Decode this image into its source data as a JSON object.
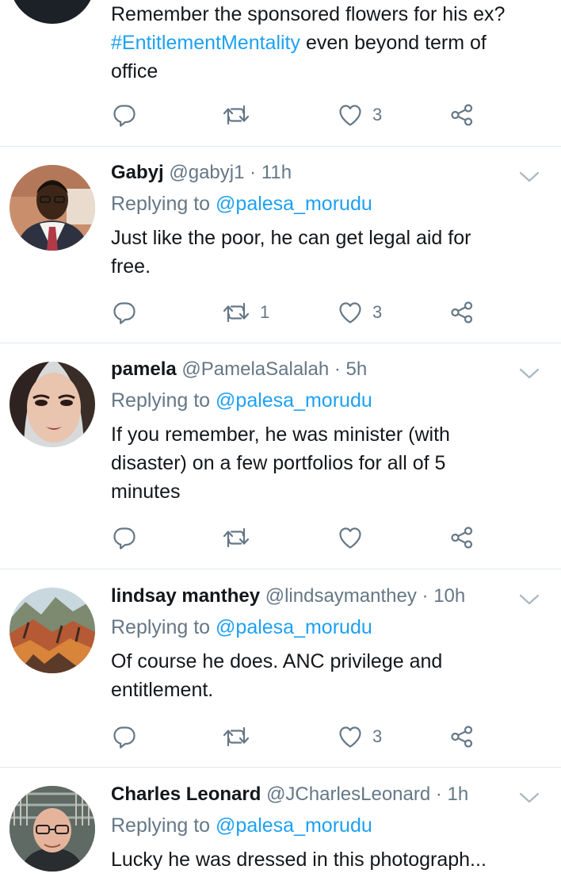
{
  "tweets": [
    {
      "body_line1": "Remember the sponsored flowers for his ex?",
      "hashtag": "#EntitlementMentality",
      "body_rest1": " even beyond term of",
      "body_line3": "office",
      "counts": {
        "reply": "",
        "retweet": "",
        "like": "3"
      }
    },
    {
      "name": "Gabyj",
      "handle": "@gabyj1",
      "time": "11h",
      "replying_prefix": "Replying to",
      "replying_to": "@palesa_morudu",
      "text": "Just like the poor, he can get legal aid for free.",
      "counts": {
        "reply": "",
        "retweet": "1",
        "like": "3"
      }
    },
    {
      "name": "pamela",
      "handle": "@PamelaSalalah",
      "time": "5h",
      "replying_prefix": "Replying to",
      "replying_to": "@palesa_morudu",
      "text": "If you remember, he was minister (with disaster) on a few portfolios for all of 5 minutes",
      "counts": {
        "reply": "",
        "retweet": "",
        "like": ""
      }
    },
    {
      "name": "lindsay manthey",
      "handle": "@lindsaymanthey",
      "time": "10h",
      "replying_prefix": "Replying to",
      "replying_to": "@palesa_morudu",
      "text": "Of course he does. ANC privilege and entitlement.",
      "counts": {
        "reply": "",
        "retweet": "",
        "like": "3"
      }
    },
    {
      "name": "Charles Leonard",
      "handle": "@JCharlesLeonard",
      "time": "1h",
      "replying_prefix": "Replying to",
      "replying_to": "@palesa_morudu",
      "text": "Lucky he was dressed in this photograph...",
      "counts": {
        "reply": "",
        "retweet": "",
        "like": ""
      }
    }
  ],
  "separator": "·",
  "colors": {
    "link": "#1da1f2",
    "secondary": "#657786",
    "divider": "#e1e8ed"
  },
  "icons": [
    "reply-icon",
    "retweet-icon",
    "like-icon",
    "share-icon",
    "chevron-down-icon"
  ]
}
